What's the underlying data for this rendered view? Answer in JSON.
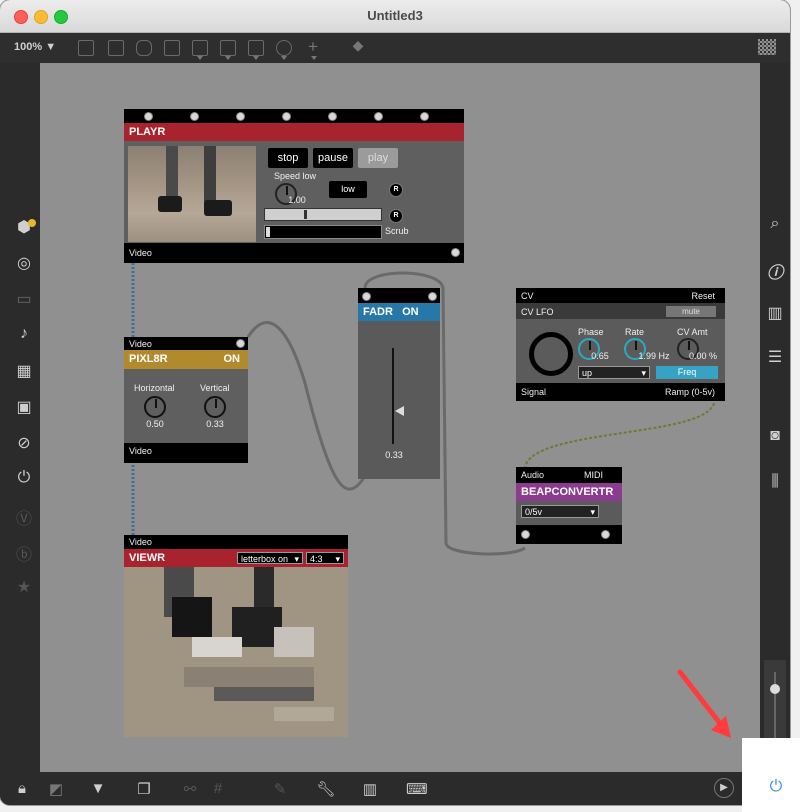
{
  "window": {
    "title": "Untitled3"
  },
  "toolbar": {
    "zoom": "100%",
    "zoom_arrow": "▼"
  },
  "modules": {
    "playr": {
      "title": "PLAYR",
      "btn_stop": "stop",
      "btn_pause": "pause",
      "btn_play": "play",
      "speed_label": "Speed low",
      "speed_value": "1.00",
      "low_button": "low",
      "r1": "R",
      "r2": "R",
      "scrub_label": "Scrub",
      "footer": "Video",
      "slider_position": 0.35
    },
    "pixl8r": {
      "top_label": "Video",
      "title": "PIXL8R",
      "status": "ON",
      "h_label": "Horizontal",
      "h_value": "0.50",
      "v_label": "Vertical",
      "v_value": "0.33",
      "footer": "Video"
    },
    "fadr": {
      "title": "FADR",
      "status": "ON",
      "value": "0.33"
    },
    "cv": {
      "top_label": "CV",
      "reset_label": "Reset",
      "lfo_label": "CV LFO",
      "mute_label": "mute",
      "phase_label": "Phase",
      "phase_value": "0.65",
      "rate_label": "Rate",
      "rate_value": "1.99 Hz",
      "amt_label": "CV Amt",
      "amt_value": "0.00 %",
      "shape_value": "up",
      "freq_label": "Freq",
      "signal_label": "Signal",
      "ramp_label": "Ramp (0-5v)"
    },
    "beap": {
      "audio_label": "Audio",
      "midi_label": "MIDI",
      "title": "BEAPCONVERTR",
      "range_value": "0/5v"
    },
    "viewr": {
      "top_label": "Video",
      "title": "VIEWR",
      "mode_value": "letterbox on",
      "aspect_value": "4:3"
    }
  },
  "colors": {
    "playr_header": "#a8232d",
    "pixl8r_header": "#b28a2e",
    "fadr_header": "#2777a8",
    "beap_header": "#8c3c8f",
    "viewr_header": "#a8232d",
    "canvas": "#909090",
    "annotation_arrow": "#ff3b3b"
  }
}
